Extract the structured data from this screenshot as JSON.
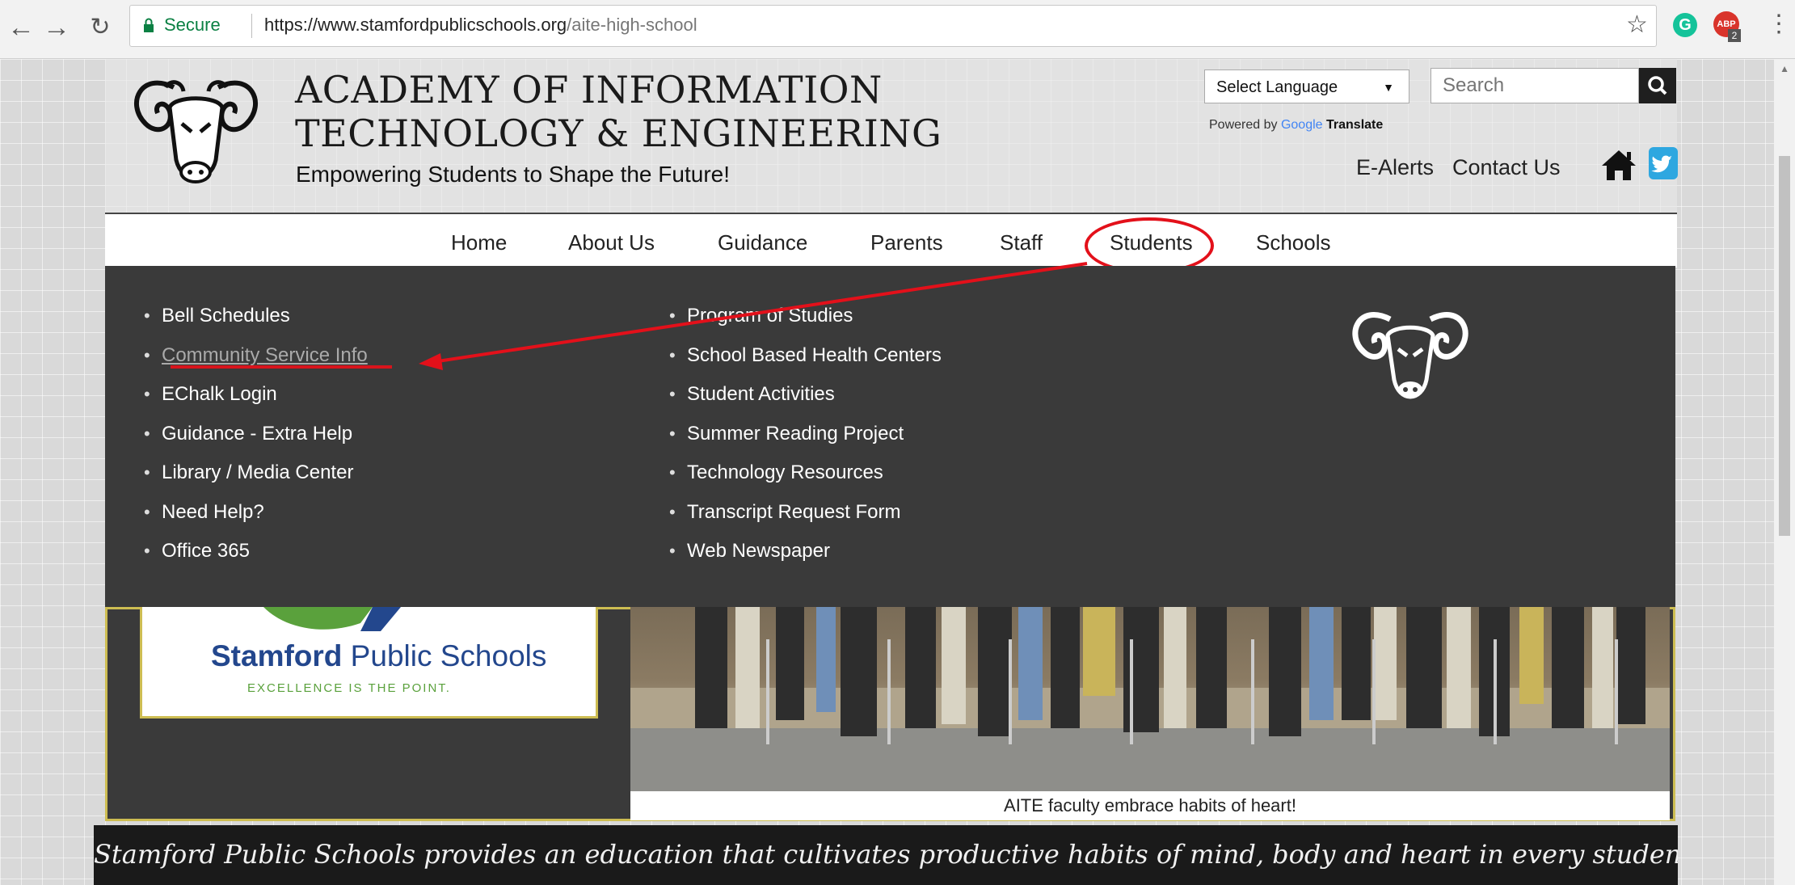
{
  "browser": {
    "secure_label": "Secure",
    "url_host": "https://www.stamfordpublicschools.org",
    "url_path": "/aite-high-school",
    "abp_badge": "2"
  },
  "header": {
    "title_line1": "ACADEMY OF INFORMATION",
    "title_line2": "TECHNOLOGY & ENGINEERING",
    "tagline": "Empowering Students to Shape the Future!",
    "language_select": "Select Language",
    "powered_by_prefix": "Powered by",
    "google": "Google",
    "translate": "Translate",
    "search_placeholder": "Search",
    "e_alerts": "E-Alerts",
    "contact_us": "Contact Us"
  },
  "nav": {
    "items": [
      "Home",
      "About Us",
      "Guidance",
      "Parents",
      "Staff",
      "Students",
      "Schools"
    ],
    "active": "Students"
  },
  "dropdown": {
    "col1": [
      "Bell Schedules",
      "Community Service Info",
      "EChalk Login",
      "Guidance - Extra Help",
      "Library / Media Center",
      "Need Help?",
      "Office 365"
    ],
    "col2": [
      "Program of Studies",
      "School Based Health Centers",
      "Student Activities",
      "Summer Reading Project",
      "Technology Resources",
      "Transcript Request Form",
      "Web Newspaper"
    ],
    "highlighted": "Community Service Info"
  },
  "district": {
    "name_bold": "Stamford",
    "name_rest": " Public Schools",
    "motto": "EXCELLENCE IS THE POINT."
  },
  "slideshow": {
    "caption": "AITE faculty embrace habits of heart!"
  },
  "mission": "Stamford Public Schools provides an education that cultivates productive habits of mind, body and heart in every student.",
  "colors": {
    "annotation_red": "#e3101a",
    "dropdown_bg": "#3a3a3a",
    "gold_border": "#cdbd52",
    "district_blue": "#23478d",
    "twitter_blue": "#2ea7e0"
  }
}
